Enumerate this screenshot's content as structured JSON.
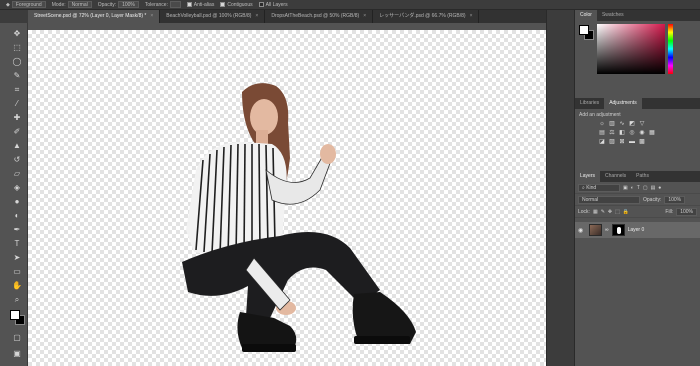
{
  "options_bar": {
    "tool_label": "",
    "preset_label": "Foreground",
    "mode_label": "Mode:",
    "mode_value": "Normal",
    "opacity_label": "Opacity:",
    "opacity_value": "100%",
    "tolerance_label": "Tolerance:",
    "antialias_label": "Anti-alias",
    "contiguous_label": "Contiguous",
    "all_layers_label": "All Layers"
  },
  "tabs": [
    {
      "label": "StreetScene.psd @ 72% (Layer 0, Layer Mask/8) *",
      "active": true
    },
    {
      "label": "BeachVolleyball.psd @ 100% (RGB/8)",
      "active": false
    },
    {
      "label": "DropsAtTheBeach.psd @ 50% (RGB/8)",
      "active": false
    },
    {
      "label": "レッサーパンダ.psd @ 66.7% (RGB/8)",
      "active": false
    }
  ],
  "tools": [
    "move-icon",
    "marquee-icon",
    "lasso-icon",
    "quick-select-icon",
    "crop-icon",
    "eyedropper-icon",
    "healing-icon",
    "brush-icon",
    "stamp-icon",
    "history-brush-icon",
    "eraser-icon",
    "gradient-icon",
    "blur-icon",
    "dodge-icon",
    "pen-icon",
    "type-icon",
    "path-select-icon",
    "shape-icon",
    "hand-icon",
    "zoom-icon",
    "more-icon"
  ],
  "color_panel": {
    "tabs": [
      "Color",
      "Swatches"
    ],
    "accent": "#d2184b"
  },
  "adjust_panel": {
    "tabs": [
      "Libraries",
      "Adjustments"
    ],
    "prompt": "Add an adjustment"
  },
  "layers_panel": {
    "tabs": [
      "Layers",
      "Channels",
      "Paths"
    ],
    "filter_label": "Kind",
    "blend_mode": "Normal",
    "opacity_label": "Opacity:",
    "opacity_value": "100%",
    "lock_label": "Lock:",
    "fill_label": "Fill:",
    "fill_value": "100%",
    "layers": [
      {
        "name": "Layer 0",
        "visible": true
      }
    ]
  }
}
